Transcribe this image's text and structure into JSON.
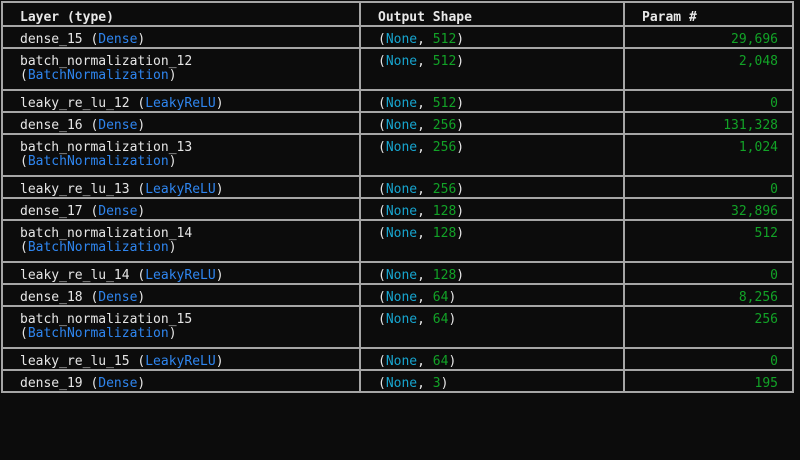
{
  "header": {
    "layer": "Layer (type)",
    "output_shape": "Output Shape",
    "params": "Param #"
  },
  "rows": [
    {
      "name": "dense_15",
      "type": "Dense",
      "wrap": false,
      "none": "None",
      "dim": "512",
      "params": "29,696"
    },
    {
      "name": "batch_normalization_12",
      "type": "BatchNormalization",
      "wrap": true,
      "none": "None",
      "dim": "512",
      "params": "2,048"
    },
    {
      "name": "leaky_re_lu_12",
      "type": "LeakyReLU",
      "wrap": false,
      "none": "None",
      "dim": "512",
      "params": "0"
    },
    {
      "name": "dense_16",
      "type": "Dense",
      "wrap": false,
      "none": "None",
      "dim": "256",
      "params": "131,328"
    },
    {
      "name": "batch_normalization_13",
      "type": "BatchNormalization",
      "wrap": true,
      "none": "None",
      "dim": "256",
      "params": "1,024"
    },
    {
      "name": "leaky_re_lu_13",
      "type": "LeakyReLU",
      "wrap": false,
      "none": "None",
      "dim": "256",
      "params": "0"
    },
    {
      "name": "dense_17",
      "type": "Dense",
      "wrap": false,
      "none": "None",
      "dim": "128",
      "params": "32,896"
    },
    {
      "name": "batch_normalization_14",
      "type": "BatchNormalization",
      "wrap": true,
      "none": "None",
      "dim": "128",
      "params": "512"
    },
    {
      "name": "leaky_re_lu_14",
      "type": "LeakyReLU",
      "wrap": false,
      "none": "None",
      "dim": "128",
      "params": "0"
    },
    {
      "name": "dense_18",
      "type": "Dense",
      "wrap": false,
      "none": "None",
      "dim": "64",
      "params": "8,256"
    },
    {
      "name": "batch_normalization_15",
      "type": "BatchNormalization",
      "wrap": true,
      "none": "None",
      "dim": "64",
      "params": "256"
    },
    {
      "name": "leaky_re_lu_15",
      "type": "LeakyReLU",
      "wrap": false,
      "none": "None",
      "dim": "64",
      "params": "0"
    },
    {
      "name": "dense_19",
      "type": "Dense",
      "wrap": false,
      "none": "None",
      "dim": "3",
      "params": "195"
    }
  ],
  "colors": {
    "background": "#0c0c0c",
    "border": "#a6a6a6",
    "layer_type": "#2f86f0",
    "none_keyword": "#17a5cf",
    "number": "#12a327"
  }
}
